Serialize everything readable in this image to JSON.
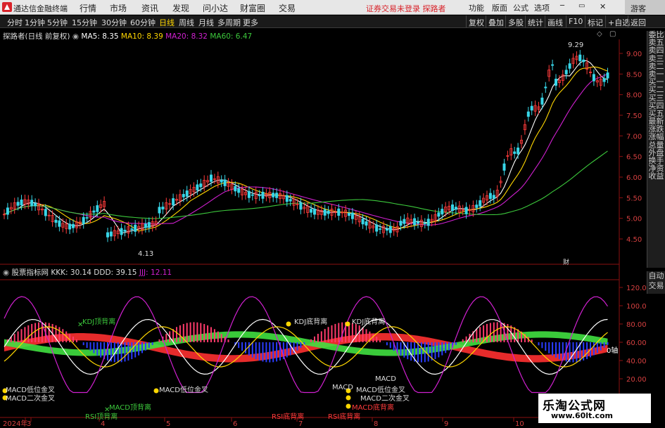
{
  "titlebar": {
    "app_title": "通达信金融终端",
    "menu": [
      "行情",
      "市场",
      "资讯",
      "发现",
      "问小达",
      "财富圈",
      "交易"
    ],
    "warning": "证券交易未登录  探路者",
    "right_buttons": [
      "功能",
      "版面",
      "公式",
      "选项"
    ],
    "guest": "游客"
  },
  "toolbar": {
    "periods": [
      "分时",
      "1分钟",
      "5分钟",
      "15分钟",
      "30分钟",
      "60分钟",
      "日线",
      "周线",
      "月线",
      "多周期",
      "更多"
    ],
    "active_period": "日线",
    "right_buttons": [
      "复权",
      "叠加",
      "多股",
      "统计",
      "画线",
      "F10",
      "标记",
      "+自选",
      "返回"
    ]
  },
  "main_legend": {
    "title": "探路者(日线 前复权)",
    "ma5": "MA5: 8.35",
    "ma10": "MA10: 8.39",
    "ma20": "MA20: 8.32",
    "ma60": "MA60: 6.47"
  },
  "sub_legend": {
    "title": "股票指标网",
    "kkk": "KKK: 30.14",
    "ddd": "DDD: 39.15",
    "jjj": "JJJ: 12.11"
  },
  "price_axis": [
    "9.00",
    "8.50",
    "8.00",
    "7.50",
    "7.00",
    "6.50",
    "6.00",
    "5.50",
    "5.00",
    "4.50"
  ],
  "price_annotations": {
    "high": "9.29",
    "low": "4.13"
  },
  "event_markers": [
    "",
    "",
    "财"
  ],
  "indicator_axis": [
    "120.0",
    "100.0",
    "80.00",
    "60.00",
    "40.00",
    "20.00"
  ],
  "indicator_zero_label": "0轴",
  "signals": {
    "kdj_top": "KDJ顶背离",
    "kdj_bottom": "KDJ底背离",
    "macd_low_gold": "MACD低位金叉",
    "macd_second_gold": "MACD二次金叉",
    "macd_top": "MACD顶背离",
    "macd_bottom": "MACD底背离",
    "rsi_top": "RSI顶背离",
    "rsi_bottom": "RSI底背离",
    "macd_short": "MACD"
  },
  "date_axis": [
    "2024年",
    "3",
    "4",
    "5",
    "6",
    "7",
    "8",
    "9",
    "10"
  ],
  "side_tabs": [
    "委比",
    "卖五",
    "卖四",
    "卖三",
    "卖二",
    "卖一",
    "买一",
    "买二",
    "买三",
    "买四",
    "买五",
    "最新",
    "涨跌",
    "涨幅",
    "总量",
    "外盘",
    "换手",
    "净资",
    "收益"
  ],
  "side_tabs2": [
    "自动",
    "交易"
  ],
  "watermark": {
    "title": "乐淘公式网",
    "url": "www.60lt.com"
  },
  "colors": {
    "up": "#ff3b3b",
    "down": "#38d6e8",
    "ma5": "#ffffff",
    "ma10": "#ffd700",
    "ma20": "#d020d0",
    "ma60": "#3cc83c"
  }
}
